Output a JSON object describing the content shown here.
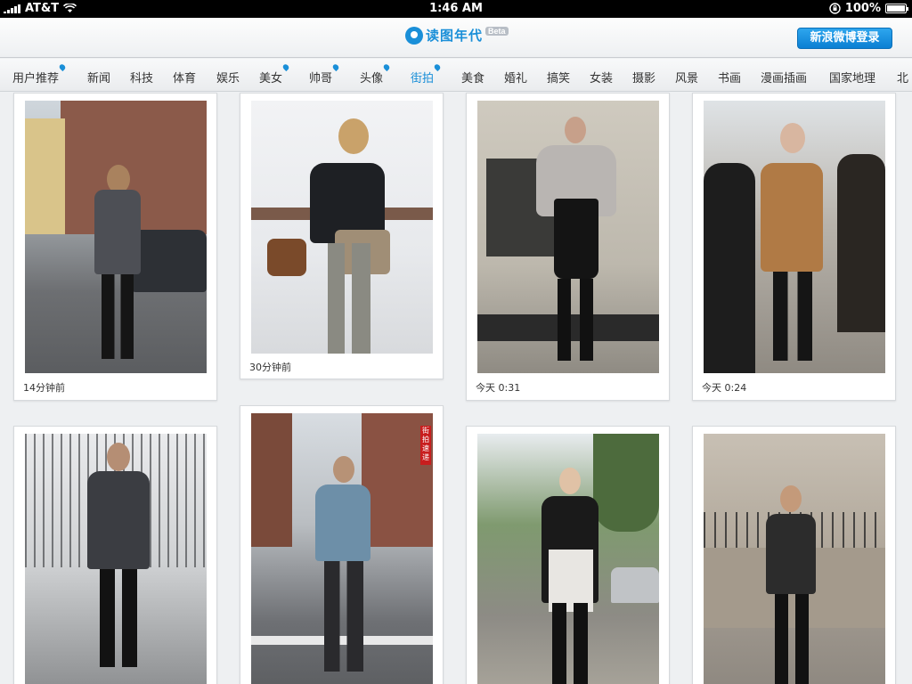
{
  "status_bar": {
    "carrier": "AT&T",
    "time": "1:46 AM",
    "battery": "100%"
  },
  "header": {
    "app_name": "读图年代",
    "beta": "Beta",
    "login_button": "新浪微博登录"
  },
  "tabs": [
    {
      "label": "用户推荐",
      "badge": true
    },
    {
      "label": "新闻"
    },
    {
      "label": "科技"
    },
    {
      "label": "体育"
    },
    {
      "label": "娱乐"
    },
    {
      "label": "美女",
      "badge": true
    },
    {
      "label": "帅哥",
      "badge": true
    },
    {
      "label": "头像",
      "badge": true
    },
    {
      "label": "街拍",
      "badge": true,
      "active": true
    },
    {
      "label": "美食"
    },
    {
      "label": "婚礼"
    },
    {
      "label": "搞笑"
    },
    {
      "label": "女装"
    },
    {
      "label": "摄影"
    },
    {
      "label": "风景"
    },
    {
      "label": "书画"
    },
    {
      "label": "漫画插画"
    },
    {
      "label": "国家地理"
    },
    {
      "label": "北"
    }
  ],
  "cards": [
    {
      "caption": "14分钟前"
    },
    {
      "caption": "30分钟前"
    },
    {
      "caption": "今天 0:31"
    },
    {
      "caption": "今天 0:24"
    },
    {
      "caption": ""
    },
    {
      "caption": "",
      "photo_text": "街拍速递"
    },
    {
      "caption": ""
    },
    {
      "caption": ""
    }
  ],
  "colors": {
    "accent": "#1a8fd8",
    "login_bg": "#1485d8"
  }
}
